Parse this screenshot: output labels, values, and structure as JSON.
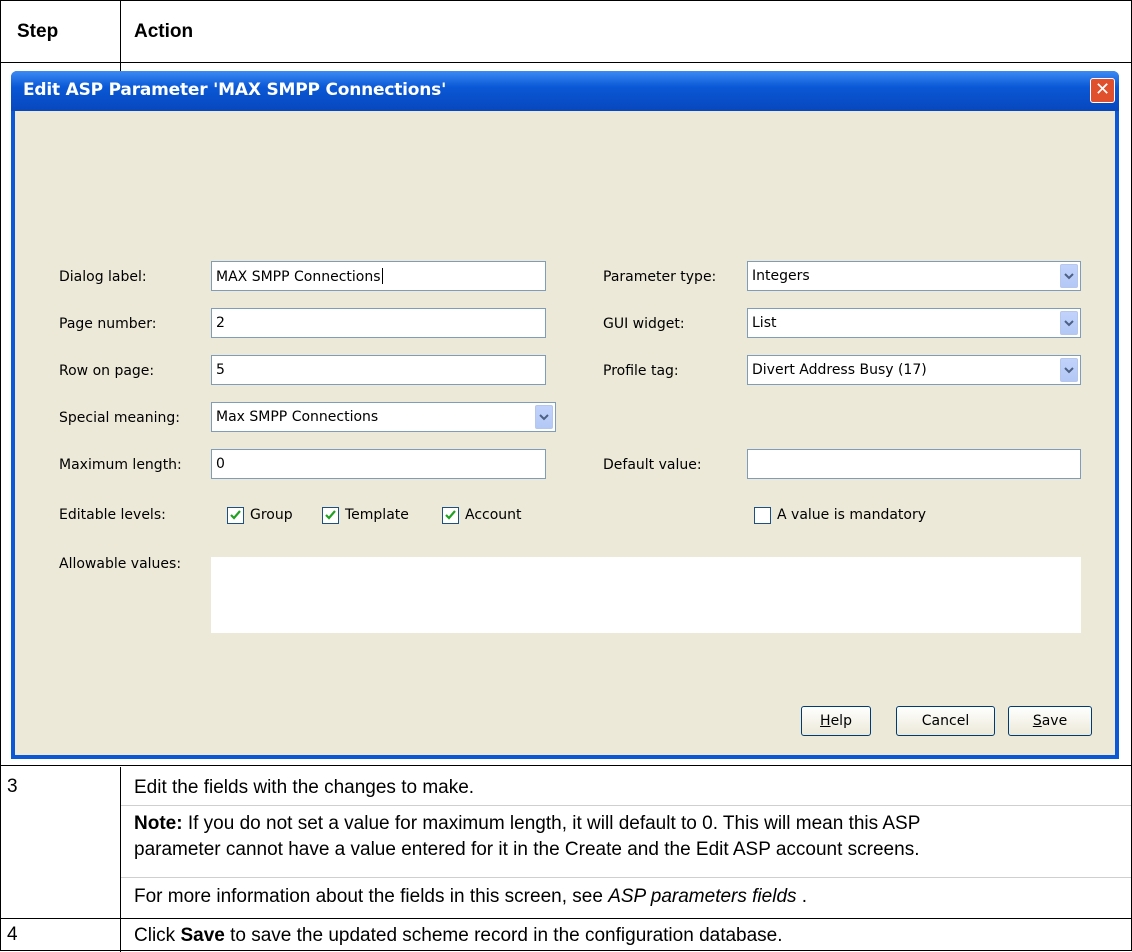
{
  "table": {
    "header": {
      "step": "Step",
      "action": "Action"
    },
    "rows": [
      {
        "step": "3",
        "p1": "Edit the fields with the changes to make.",
        "note_label": "Note:",
        "note_line1": " If you do not set a value for maximum length, it will default to 0. This will mean this ASP",
        "note_line2": "parameter cannot have a value entered for it in the Create and the Edit ASP account screens.",
        "more_prefix": "For more information about the fields in this screen, see ",
        "more_link": "ASP parameters fields",
        "more_suffix": " ."
      },
      {
        "step": "4",
        "prefix": "Click ",
        "bold": "Save",
        "suffix": " to save the updated scheme record in the configuration database."
      }
    ]
  },
  "dialog": {
    "title": "Edit ASP Parameter 'MAX SMPP Connections'",
    "close_glyph": "✕",
    "labels": {
      "dialog_label": "Dialog label:",
      "page_number": "Page number:",
      "row_on_page": "Row on page:",
      "special_meaning": "Special meaning:",
      "maximum_length": "Maximum length:",
      "editable_levels": "Editable levels:",
      "allowable_values": "Allowable values:",
      "parameter_type": "Parameter type:",
      "gui_widget": "GUI widget:",
      "profile_tag": "Profile tag:",
      "default_value": "Default value:"
    },
    "values": {
      "dialog_label": "MAX SMPP Connections",
      "page_number": "2",
      "row_on_page": "5",
      "special_meaning": "Max SMPP Connections",
      "maximum_length": "0",
      "parameter_type": "Integers",
      "gui_widget": "List",
      "profile_tag": "Divert Address Busy (17)",
      "default_value": "",
      "allowable_values": ""
    },
    "checkboxes": {
      "group": {
        "label": "Group",
        "checked": true
      },
      "template": {
        "label": "Template",
        "checked": true
      },
      "account": {
        "label": "Account",
        "checked": true
      },
      "mandatory": {
        "label": "A value is mandatory",
        "checked": false
      }
    },
    "buttons": {
      "help": {
        "first": "H",
        "rest": "elp"
      },
      "cancel": "Cancel",
      "save": {
        "first": "S",
        "rest": "ave"
      }
    },
    "icons": {
      "dropdown": "chevron-down-icon",
      "check": "check-icon",
      "close": "close-icon"
    },
    "colors": {
      "title_bar": "#0a58d6",
      "client_bg": "#ece9d8",
      "close_btn": "#e0502c",
      "field_border": "#7f9db9",
      "checkbox_border": "#1c5180",
      "check": "#21a121"
    }
  }
}
